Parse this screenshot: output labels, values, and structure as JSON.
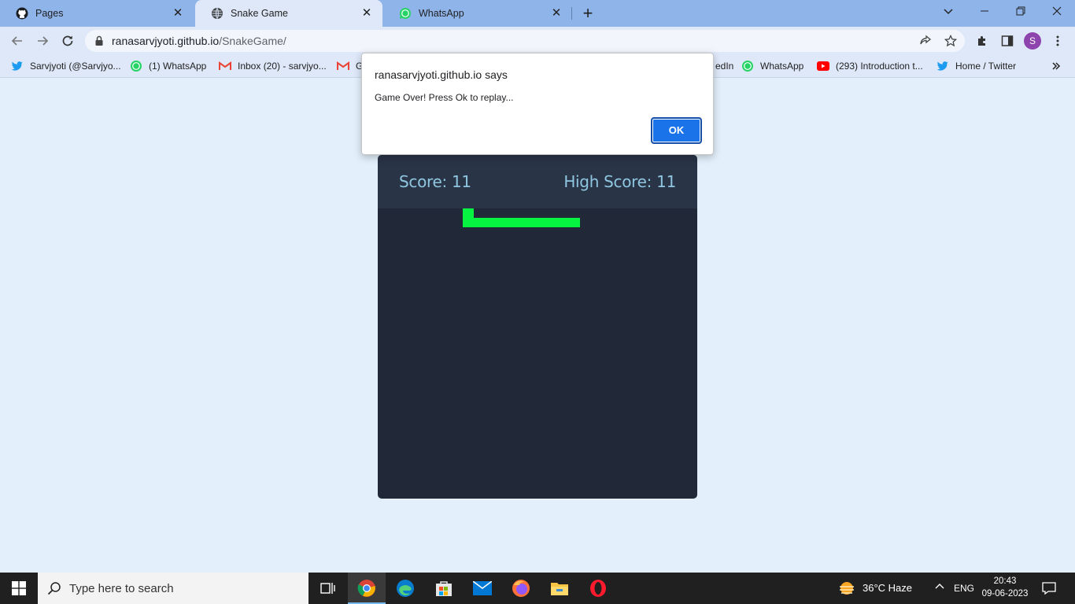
{
  "browser": {
    "tabs": [
      {
        "title": "Pages",
        "icon": "github-icon"
      },
      {
        "title": "Snake Game",
        "icon": "globe-icon",
        "active": true
      },
      {
        "title": "WhatsApp",
        "icon": "whatsapp-icon"
      }
    ],
    "url_host": "ranasarvjyoti.github.io",
    "url_path": "/SnakeGame/",
    "profile_initial": "S",
    "bookmarks": [
      {
        "label": "Sarvjyoti (@Sarvjyo...",
        "icon": "twitter-icon"
      },
      {
        "label": "(1) WhatsApp",
        "icon": "whatsapp-icon"
      },
      {
        "label": "Inbox (20) - sarvjyo...",
        "icon": "gmail-icon"
      },
      {
        "label": "G",
        "icon": "gmail-icon"
      },
      {
        "label": "edIn",
        "icon": "linkedin-icon"
      },
      {
        "label": "WhatsApp",
        "icon": "whatsapp-icon"
      },
      {
        "label": "(293) Introduction t...",
        "icon": "youtube-icon"
      },
      {
        "label": "Home / Twitter",
        "icon": "twitter-icon"
      }
    ]
  },
  "dialog": {
    "title": "ranasarvjyoti.github.io says",
    "message": "Game Over! Press Ok to replay...",
    "ok_label": "OK"
  },
  "game": {
    "score_label": "Score: 11",
    "high_score_label": "High Score: 11",
    "score": 11,
    "high_score": 11,
    "snake_color": "#06f342"
  },
  "taskbar": {
    "search_placeholder": "Type here to search",
    "weather": "36°C  Haze",
    "language": "ENG",
    "time": "20:43",
    "date": "09-06-2023"
  },
  "colors": {
    "accent": "#1a73e8",
    "page_background": "#e3f0fb",
    "board_background": "#212837",
    "score_text": "#8fc6e0"
  }
}
